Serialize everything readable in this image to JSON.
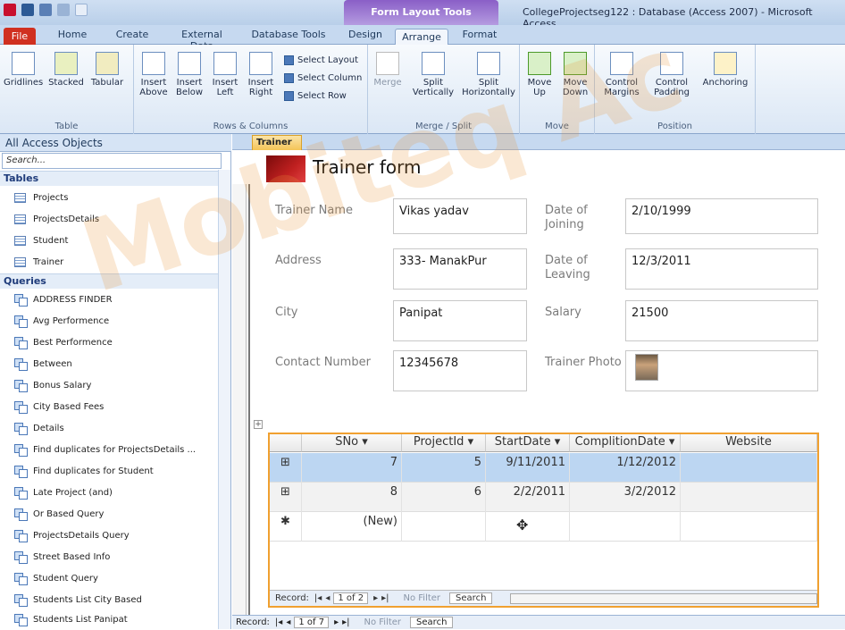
{
  "window": {
    "title": "CollegeProjectseg122 : Database (Access 2007)  -  Microsoft Access",
    "context_tools": "Form Layout Tools"
  },
  "tabs": [
    "File",
    "Home",
    "Create",
    "External Data",
    "Database Tools",
    "Design",
    "Arrange",
    "Format"
  ],
  "active_tab": "Arrange",
  "ribbon": {
    "table_group": {
      "label": "Table",
      "buttons": [
        "Gridlines",
        "Stacked",
        "Tabular"
      ]
    },
    "rows_cols_group": {
      "label": "Rows & Columns",
      "buttons": [
        "Insert Above",
        "Insert Below",
        "Insert Left",
        "Insert Right"
      ],
      "small": [
        "Select Layout",
        "Select Column",
        "Select Row"
      ]
    },
    "merge_group": {
      "label": "Merge / Split",
      "buttons": [
        "Merge",
        "Split Vertically",
        "Split Horizontally"
      ]
    },
    "move_group": {
      "label": "Move",
      "buttons": [
        "Move Up",
        "Move Down"
      ]
    },
    "position_group": {
      "label": "Position",
      "buttons": [
        "Control Margins",
        "Control Padding",
        "Anchoring"
      ]
    }
  },
  "nav": {
    "header": "All Access Objects",
    "search_placeholder": "Search...",
    "tables_label": "Tables",
    "tables": [
      "Projects",
      "ProjectsDetails",
      "Student",
      "Trainer"
    ],
    "queries_label": "Queries",
    "queries": [
      "ADDRESS FINDER",
      "Avg Performence",
      "Best Performence",
      "Between",
      "Bonus Salary",
      "City Based Fees",
      "Details",
      "Find duplicates for ProjectsDetails ...",
      "Find duplicates for Student",
      "Late Project (and)",
      "Or Based Query",
      "ProjectsDetails Query",
      "Street Based Info",
      "Student Query",
      "Students List City Based",
      "Students List Panipat"
    ]
  },
  "doc_tab": "Trainer",
  "form": {
    "title": "Trainer form",
    "fields": [
      {
        "label": "Trainer Name",
        "value": "Vikas yadav"
      },
      {
        "label": "Date of Joining",
        "value": "2/10/1999"
      },
      {
        "label": "Address",
        "value": "333- ManakPur"
      },
      {
        "label": "Date of Leaving",
        "value": "12/3/2011"
      },
      {
        "label": "City",
        "value": "Panipat"
      },
      {
        "label": "Salary",
        "value": "21500"
      },
      {
        "label": "Contact Number",
        "value": "12345678"
      },
      {
        "label": "Trainer Photo",
        "value": ""
      }
    ]
  },
  "subform": {
    "columns": [
      "SNo",
      "ProjectId",
      "StartDate",
      "ComplitionDate",
      "Website"
    ],
    "rows": [
      [
        "7",
        "5",
        "9/11/2011",
        "1/12/2012",
        ""
      ],
      [
        "8",
        "6",
        "2/2/2011",
        "3/2/2012",
        ""
      ]
    ],
    "new_row": "(New)",
    "record_label": "Record:",
    "record_pos": "1 of 2",
    "filter": "No Filter",
    "search": "Search"
  },
  "record_bar": {
    "label": "Record:",
    "pos": "1 of 7",
    "filter": "No Filter",
    "search": "Search"
  },
  "watermark": "Mobiteq Ac"
}
